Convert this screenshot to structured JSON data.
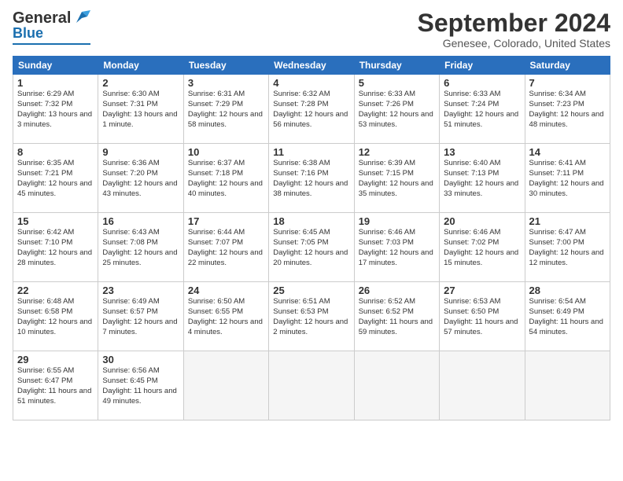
{
  "header": {
    "logo_top": "General",
    "logo_bottom": "Blue",
    "title": "September 2024",
    "subtitle": "Genesee, Colorado, United States"
  },
  "weekdays": [
    "Sunday",
    "Monday",
    "Tuesday",
    "Wednesday",
    "Thursday",
    "Friday",
    "Saturday"
  ],
  "weeks": [
    [
      {
        "day": "1",
        "sunrise": "Sunrise: 6:29 AM",
        "sunset": "Sunset: 7:32 PM",
        "daylight": "Daylight: 13 hours and 3 minutes."
      },
      {
        "day": "2",
        "sunrise": "Sunrise: 6:30 AM",
        "sunset": "Sunset: 7:31 PM",
        "daylight": "Daylight: 13 hours and 1 minute."
      },
      {
        "day": "3",
        "sunrise": "Sunrise: 6:31 AM",
        "sunset": "Sunset: 7:29 PM",
        "daylight": "Daylight: 12 hours and 58 minutes."
      },
      {
        "day": "4",
        "sunrise": "Sunrise: 6:32 AM",
        "sunset": "Sunset: 7:28 PM",
        "daylight": "Daylight: 12 hours and 56 minutes."
      },
      {
        "day": "5",
        "sunrise": "Sunrise: 6:33 AM",
        "sunset": "Sunset: 7:26 PM",
        "daylight": "Daylight: 12 hours and 53 minutes."
      },
      {
        "day": "6",
        "sunrise": "Sunrise: 6:33 AM",
        "sunset": "Sunset: 7:24 PM",
        "daylight": "Daylight: 12 hours and 51 minutes."
      },
      {
        "day": "7",
        "sunrise": "Sunrise: 6:34 AM",
        "sunset": "Sunset: 7:23 PM",
        "daylight": "Daylight: 12 hours and 48 minutes."
      }
    ],
    [
      {
        "day": "8",
        "sunrise": "Sunrise: 6:35 AM",
        "sunset": "Sunset: 7:21 PM",
        "daylight": "Daylight: 12 hours and 45 minutes."
      },
      {
        "day": "9",
        "sunrise": "Sunrise: 6:36 AM",
        "sunset": "Sunset: 7:20 PM",
        "daylight": "Daylight: 12 hours and 43 minutes."
      },
      {
        "day": "10",
        "sunrise": "Sunrise: 6:37 AM",
        "sunset": "Sunset: 7:18 PM",
        "daylight": "Daylight: 12 hours and 40 minutes."
      },
      {
        "day": "11",
        "sunrise": "Sunrise: 6:38 AM",
        "sunset": "Sunset: 7:16 PM",
        "daylight": "Daylight: 12 hours and 38 minutes."
      },
      {
        "day": "12",
        "sunrise": "Sunrise: 6:39 AM",
        "sunset": "Sunset: 7:15 PM",
        "daylight": "Daylight: 12 hours and 35 minutes."
      },
      {
        "day": "13",
        "sunrise": "Sunrise: 6:40 AM",
        "sunset": "Sunset: 7:13 PM",
        "daylight": "Daylight: 12 hours and 33 minutes."
      },
      {
        "day": "14",
        "sunrise": "Sunrise: 6:41 AM",
        "sunset": "Sunset: 7:11 PM",
        "daylight": "Daylight: 12 hours and 30 minutes."
      }
    ],
    [
      {
        "day": "15",
        "sunrise": "Sunrise: 6:42 AM",
        "sunset": "Sunset: 7:10 PM",
        "daylight": "Daylight: 12 hours and 28 minutes."
      },
      {
        "day": "16",
        "sunrise": "Sunrise: 6:43 AM",
        "sunset": "Sunset: 7:08 PM",
        "daylight": "Daylight: 12 hours and 25 minutes."
      },
      {
        "day": "17",
        "sunrise": "Sunrise: 6:44 AM",
        "sunset": "Sunset: 7:07 PM",
        "daylight": "Daylight: 12 hours and 22 minutes."
      },
      {
        "day": "18",
        "sunrise": "Sunrise: 6:45 AM",
        "sunset": "Sunset: 7:05 PM",
        "daylight": "Daylight: 12 hours and 20 minutes."
      },
      {
        "day": "19",
        "sunrise": "Sunrise: 6:46 AM",
        "sunset": "Sunset: 7:03 PM",
        "daylight": "Daylight: 12 hours and 17 minutes."
      },
      {
        "day": "20",
        "sunrise": "Sunrise: 6:46 AM",
        "sunset": "Sunset: 7:02 PM",
        "daylight": "Daylight: 12 hours and 15 minutes."
      },
      {
        "day": "21",
        "sunrise": "Sunrise: 6:47 AM",
        "sunset": "Sunset: 7:00 PM",
        "daylight": "Daylight: 12 hours and 12 minutes."
      }
    ],
    [
      {
        "day": "22",
        "sunrise": "Sunrise: 6:48 AM",
        "sunset": "Sunset: 6:58 PM",
        "daylight": "Daylight: 12 hours and 10 minutes."
      },
      {
        "day": "23",
        "sunrise": "Sunrise: 6:49 AM",
        "sunset": "Sunset: 6:57 PM",
        "daylight": "Daylight: 12 hours and 7 minutes."
      },
      {
        "day": "24",
        "sunrise": "Sunrise: 6:50 AM",
        "sunset": "Sunset: 6:55 PM",
        "daylight": "Daylight: 12 hours and 4 minutes."
      },
      {
        "day": "25",
        "sunrise": "Sunrise: 6:51 AM",
        "sunset": "Sunset: 6:53 PM",
        "daylight": "Daylight: 12 hours and 2 minutes."
      },
      {
        "day": "26",
        "sunrise": "Sunrise: 6:52 AM",
        "sunset": "Sunset: 6:52 PM",
        "daylight": "Daylight: 11 hours and 59 minutes."
      },
      {
        "day": "27",
        "sunrise": "Sunrise: 6:53 AM",
        "sunset": "Sunset: 6:50 PM",
        "daylight": "Daylight: 11 hours and 57 minutes."
      },
      {
        "day": "28",
        "sunrise": "Sunrise: 6:54 AM",
        "sunset": "Sunset: 6:49 PM",
        "daylight": "Daylight: 11 hours and 54 minutes."
      }
    ],
    [
      {
        "day": "29",
        "sunrise": "Sunrise: 6:55 AM",
        "sunset": "Sunset: 6:47 PM",
        "daylight": "Daylight: 11 hours and 51 minutes."
      },
      {
        "day": "30",
        "sunrise": "Sunrise: 6:56 AM",
        "sunset": "Sunset: 6:45 PM",
        "daylight": "Daylight: 11 hours and 49 minutes."
      },
      null,
      null,
      null,
      null,
      null
    ]
  ]
}
